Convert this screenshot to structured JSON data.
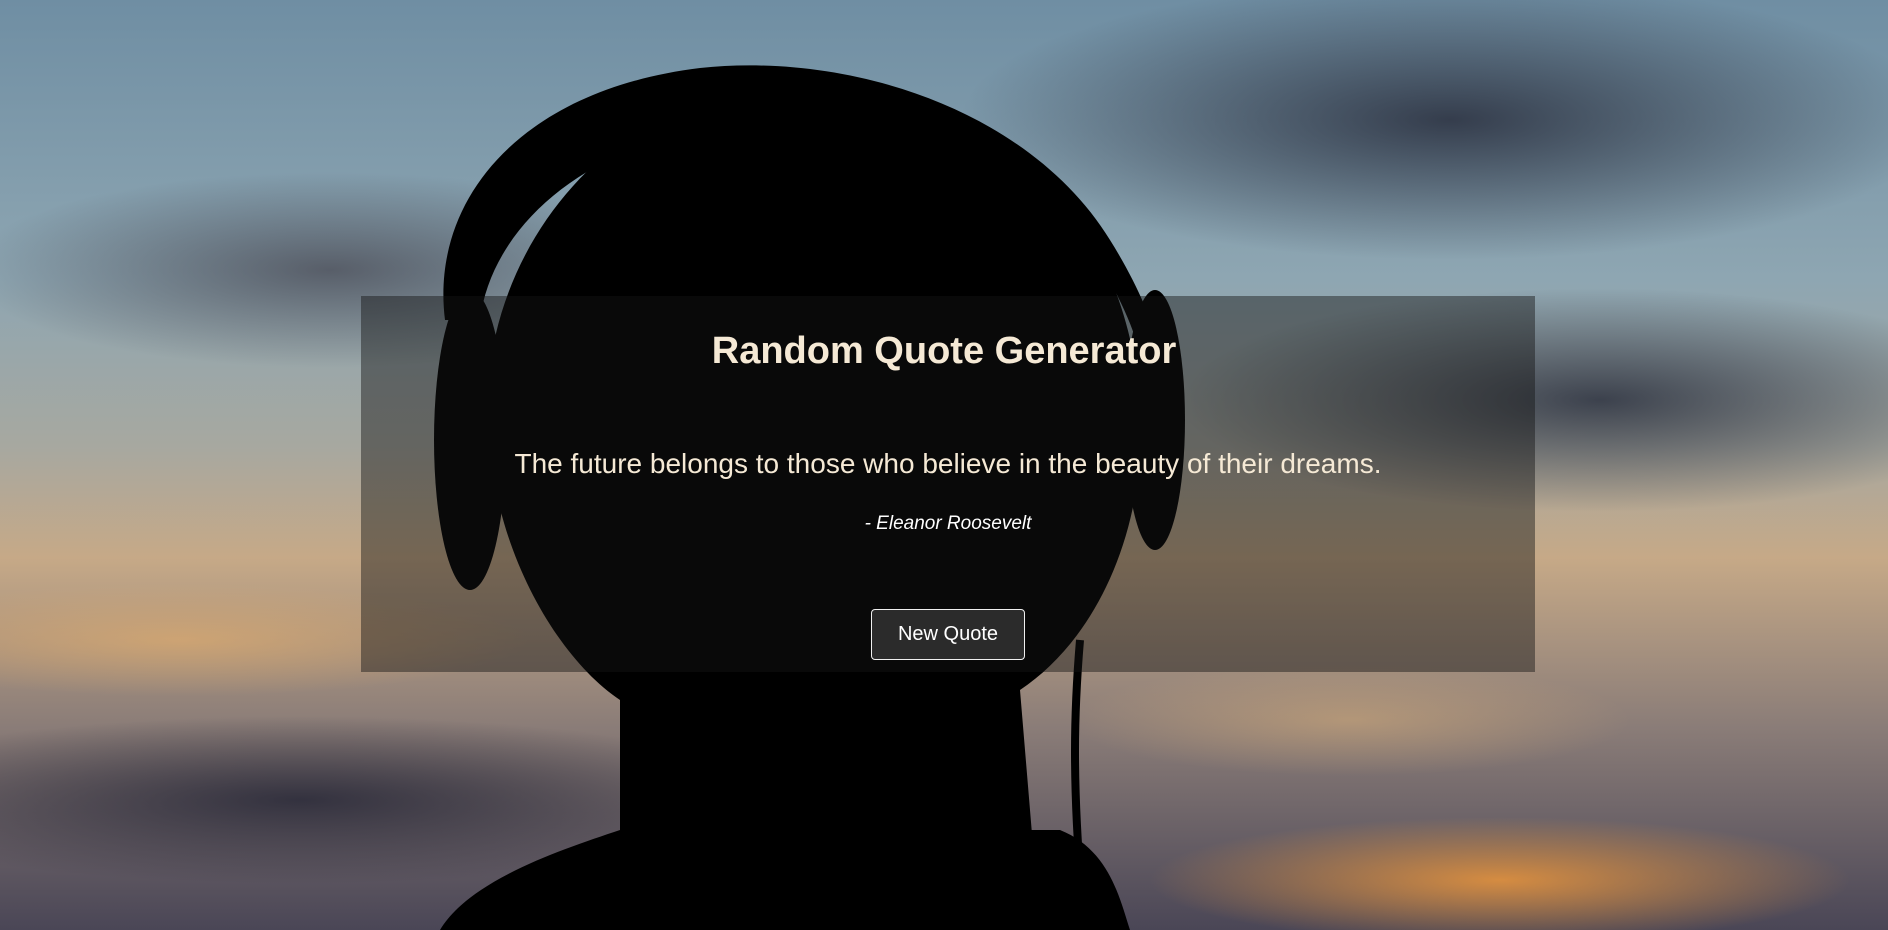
{
  "app": {
    "title": "Random Quote Generator"
  },
  "quote": {
    "text": "The future belongs to those who believe in the beauty of their dreams.",
    "author": "- Eleanor Roosevelt"
  },
  "actions": {
    "new_quote_label": "New Quote"
  },
  "colors": {
    "title_text": "#f5e9d5",
    "panel_overlay": "rgba(20,20,20,0.45)",
    "button_bg": "#2b2b2b"
  }
}
